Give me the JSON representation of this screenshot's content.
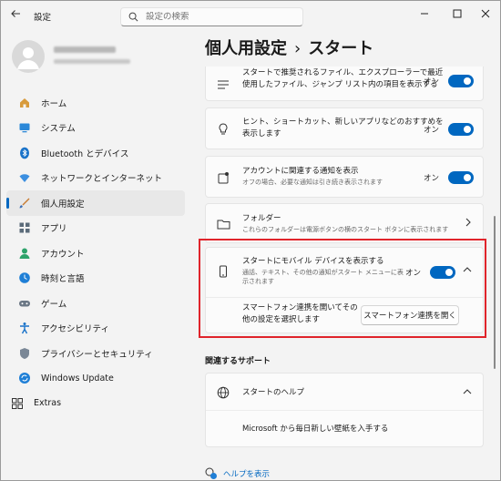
{
  "window": {
    "title": "設定"
  },
  "search": {
    "placeholder": "設定の検索"
  },
  "sidebar": {
    "items": [
      {
        "label": "ホーム",
        "icon": "home-icon"
      },
      {
        "label": "システム",
        "icon": "system-icon"
      },
      {
        "label": "Bluetooth とデバイス",
        "icon": "bluetooth-icon"
      },
      {
        "label": "ネットワークとインターネット",
        "icon": "network-icon"
      },
      {
        "label": "個人用設定",
        "icon": "personalization-icon",
        "active": true
      },
      {
        "label": "アプリ",
        "icon": "apps-icon"
      },
      {
        "label": "アカウント",
        "icon": "account-icon"
      },
      {
        "label": "時刻と言語",
        "icon": "time-language-icon"
      },
      {
        "label": "ゲーム",
        "icon": "gaming-icon"
      },
      {
        "label": "アクセシビリティ",
        "icon": "accessibility-icon"
      },
      {
        "label": "プライバシーとセキュリティ",
        "icon": "privacy-shield-icon"
      },
      {
        "label": "Windows Update",
        "icon": "windows-update-icon"
      }
    ],
    "extras": "Extras"
  },
  "breadcrumb": {
    "parent": "個人用設定",
    "separator": "›",
    "current": "スタート"
  },
  "settings": {
    "recommended_files": {
      "line1": "スタートで推奨されるファイル、エクスプローラーで最近",
      "line2": "使用したファイル、ジャンプ リスト内の項目を表示する",
      "state": "オン"
    },
    "tips": {
      "line1": "ヒント、ショートカット、新しいアプリなどのおすすめを",
      "line2": "表示します",
      "state": "オン"
    },
    "account_notifications": {
      "title": "アカウントに関連する通知を表示",
      "subtitle": "オフの場合、必要な通知は引き続き表示されます",
      "state": "オン"
    },
    "folders": {
      "title": "フォルダー",
      "subtitle": "これらのフォルダーは電源ボタンの横のスタート ボタンに表示されます"
    },
    "mobile_device": {
      "title": "スタートにモバイル デバイスを表示する",
      "subtitle1": "通話、テキスト、その他の通知がスタート メニューに表",
      "subtitle2": "示されます",
      "state": "オン",
      "detail_line1": "スマートフォン連携を開いてその",
      "detail_line2": "他の設定を選択します",
      "button": "スマートフォン連携を開く"
    }
  },
  "support": {
    "heading": "関連するサポート",
    "help_title": "スタートのヘルプ",
    "link": "Microsoft から毎日新しい壁紙を入手する"
  },
  "footer": {
    "help_link": "ヘルプを表示"
  },
  "colors": {
    "accent": "#0067c0",
    "highlight_box": "#e0242b"
  }
}
